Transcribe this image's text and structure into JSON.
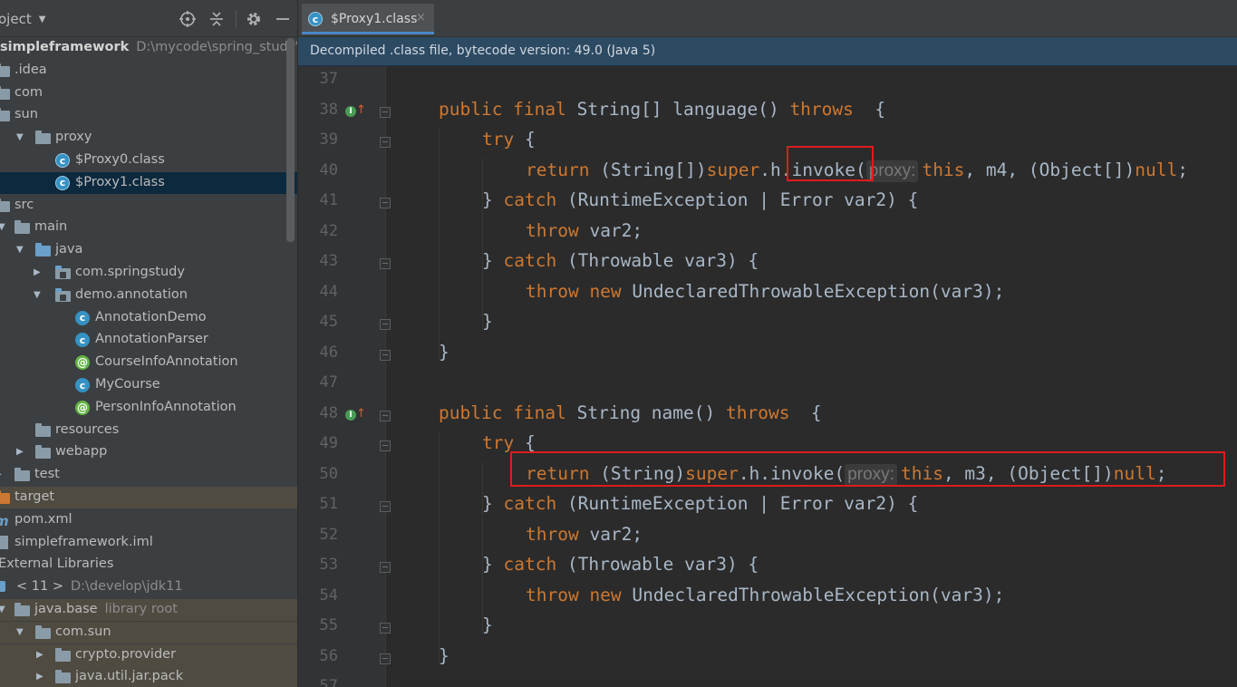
{
  "sidebar": {
    "title": "oject",
    "header_icons": [
      "crosshair-icon",
      "collapse-icon",
      "gear-icon",
      "minimize-icon"
    ],
    "tree": [
      {
        "label": "simpleframework",
        "path": "D:\\mycode\\spring_study\\simpl",
        "kind": "module",
        "arrow": ""
      },
      {
        "label": ".idea",
        "kind": "folder",
        "arrow": ""
      },
      {
        "label": "com",
        "kind": "folder",
        "arrow": ""
      },
      {
        "label": "sun",
        "kind": "folder",
        "arrow": "open"
      },
      {
        "label": "proxy",
        "kind": "folder",
        "arrow": "open"
      },
      {
        "label": "$Proxy0.class",
        "kind": "class-file",
        "arrow": ""
      },
      {
        "label": "$Proxy1.class",
        "kind": "class-file",
        "arrow": "",
        "selected": true
      },
      {
        "label": "src",
        "kind": "folder",
        "arrow": ""
      },
      {
        "label": "main",
        "kind": "folder",
        "arrow": "open"
      },
      {
        "label": "java",
        "kind": "folder-blue",
        "arrow": "open"
      },
      {
        "label": "com.springstudy",
        "kind": "package",
        "arrow": "closed"
      },
      {
        "label": "demo.annotation",
        "kind": "package",
        "arrow": "open"
      },
      {
        "label": "AnnotationDemo",
        "kind": "class",
        "arrow": ""
      },
      {
        "label": "AnnotationParser",
        "kind": "class",
        "arrow": ""
      },
      {
        "label": "CourseInfoAnnotation",
        "kind": "annotation",
        "arrow": ""
      },
      {
        "label": "MyCourse",
        "kind": "class",
        "arrow": ""
      },
      {
        "label": "PersonInfoAnnotation",
        "kind": "annotation",
        "arrow": ""
      },
      {
        "label": "resources",
        "kind": "folder",
        "arrow": ""
      },
      {
        "label": "webapp",
        "kind": "folder",
        "arrow": "closed"
      },
      {
        "label": "test",
        "kind": "folder",
        "arrow": "closed"
      },
      {
        "label": "target",
        "kind": "folder-orange",
        "arrow": "",
        "excluded": true
      },
      {
        "label": "pom.xml",
        "kind": "maven",
        "arrow": ""
      },
      {
        "label": "simpleframework.iml",
        "kind": "file",
        "arrow": ""
      },
      {
        "label": "External Libraries",
        "kind": "libs",
        "arrow": ""
      },
      {
        "label": "< 11 >",
        "path": "D:\\develop\\jdk11",
        "kind": "jdk",
        "arrow": ""
      },
      {
        "label": "java.base",
        "path": "library root",
        "kind": "folder",
        "arrow": "open",
        "excluded": true
      },
      {
        "label": "com.sun",
        "kind": "folder",
        "arrow": "open",
        "excluded": true
      },
      {
        "label": "crypto.provider",
        "kind": "folder",
        "arrow": "closed",
        "excluded": true
      },
      {
        "label": "java.util.jar.pack",
        "kind": "folder",
        "arrow": "closed",
        "excluded": true
      }
    ]
  },
  "editor": {
    "tab_label": "$Proxy1.class",
    "tab_close": "×",
    "banner": "Decompiled .class file, bytecode version: 49.0 (Java 5)",
    "lines": [
      {
        "n": "37",
        "t": []
      },
      {
        "n": "38",
        "t": [
          [
            "k",
            "public final "
          ],
          [
            "p",
            "String[] language() "
          ],
          [
            "k",
            "throws"
          ],
          [
            "p",
            "  {"
          ]
        ]
      },
      {
        "n": "39",
        "t": [
          [
            "k",
            "try"
          ],
          [
            "p",
            " {"
          ]
        ]
      },
      {
        "n": "40",
        "t": [
          [
            "k",
            "return "
          ],
          [
            "p",
            "(String[])"
          ],
          [
            "k",
            "super"
          ],
          [
            "p",
            ".h.invoke("
          ],
          [
            "h",
            "proxy:"
          ],
          [
            "k",
            "this"
          ],
          [
            "p",
            ", m4, (Object[])"
          ],
          [
            "k",
            "null"
          ],
          [
            "p",
            ";"
          ]
        ]
      },
      {
        "n": "41",
        "t": [
          [
            "p",
            "} "
          ],
          [
            "k",
            "catch "
          ],
          [
            "p",
            "(RuntimeException | Error var2) {"
          ]
        ]
      },
      {
        "n": "42",
        "t": [
          [
            "k",
            "throw "
          ],
          [
            "p",
            "var2;"
          ]
        ]
      },
      {
        "n": "43",
        "t": [
          [
            "p",
            "} "
          ],
          [
            "k",
            "catch "
          ],
          [
            "p",
            "(Throwable var3) {"
          ]
        ]
      },
      {
        "n": "44",
        "t": [
          [
            "k",
            "throw new "
          ],
          [
            "p",
            "UndeclaredThrowableException(var3);"
          ]
        ]
      },
      {
        "n": "45",
        "t": [
          [
            "p",
            "}"
          ]
        ]
      },
      {
        "n": "46",
        "t": [
          [
            "p",
            "}"
          ]
        ]
      },
      {
        "n": "47",
        "t": []
      },
      {
        "n": "48",
        "t": [
          [
            "k",
            "public final "
          ],
          [
            "p",
            "String name() "
          ],
          [
            "k",
            "throws"
          ],
          [
            "p",
            "  {"
          ]
        ]
      },
      {
        "n": "49",
        "t": [
          [
            "k",
            "try"
          ],
          [
            "p",
            " {"
          ]
        ]
      },
      {
        "n": "50",
        "t": [
          [
            "k",
            "return "
          ],
          [
            "p",
            "(String)"
          ],
          [
            "k",
            "super"
          ],
          [
            "p",
            ".h.invoke("
          ],
          [
            "h",
            "proxy:"
          ],
          [
            "k",
            "this"
          ],
          [
            "p",
            ", m3, (Object[])"
          ],
          [
            "k",
            "null"
          ],
          [
            "p",
            ";"
          ]
        ]
      },
      {
        "n": "51",
        "t": [
          [
            "p",
            "} "
          ],
          [
            "k",
            "catch "
          ],
          [
            "p",
            "(RuntimeException | Error var2) {"
          ]
        ]
      },
      {
        "n": "52",
        "t": [
          [
            "k",
            "throw "
          ],
          [
            "p",
            "var2;"
          ]
        ]
      },
      {
        "n": "53",
        "t": [
          [
            "p",
            "} "
          ],
          [
            "k",
            "catch "
          ],
          [
            "p",
            "(Throwable var3) {"
          ]
        ]
      },
      {
        "n": "54",
        "t": [
          [
            "k",
            "throw new "
          ],
          [
            "p",
            "UndeclaredThrowableException(var3);"
          ]
        ]
      },
      {
        "n": "55",
        "t": [
          [
            "p",
            "}"
          ]
        ]
      },
      {
        "n": "56",
        "t": [
          [
            "p",
            "}"
          ]
        ]
      },
      {
        "n": "57",
        "t": []
      }
    ]
  },
  "colors": {
    "keyword": "#cc7832",
    "plain": "#a9b7c6",
    "highlight_box": "#e01b1b",
    "selection": "#0d293e"
  }
}
